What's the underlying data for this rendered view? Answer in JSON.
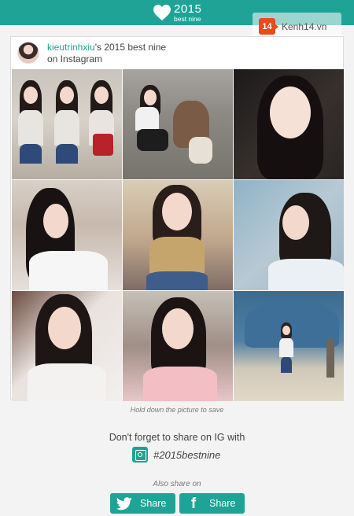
{
  "header": {
    "year": "2015",
    "subtitle": "best nine",
    "brand_color": "#1fa396"
  },
  "watermark": {
    "badge": "14",
    "text": "Kenh14.vn"
  },
  "card": {
    "username": "kieutrinhxiu",
    "title_suffix": "'s 2015 best nine",
    "platform": "on Instagram"
  },
  "photos": [
    {
      "icon": "photo-1"
    },
    {
      "icon": "photo-2"
    },
    {
      "icon": "photo-3"
    },
    {
      "icon": "photo-4"
    },
    {
      "icon": "photo-5"
    },
    {
      "icon": "photo-6"
    },
    {
      "icon": "photo-7"
    },
    {
      "icon": "photo-8"
    },
    {
      "icon": "photo-9"
    }
  ],
  "caption": "Hold down the picture to save",
  "share": {
    "prompt": "Don't forget to share on IG with",
    "hashtag": "#2015bestnine",
    "also": "Also share on",
    "twitter_label": "Share",
    "facebook_label": "Share"
  }
}
